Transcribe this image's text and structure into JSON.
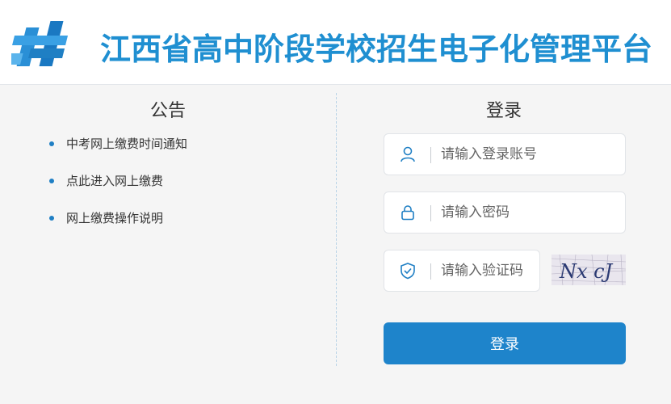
{
  "header": {
    "title": "江西省高中阶段学校招生电子化管理平台",
    "logo_icon": "cp-logo-icon",
    "brand_color": "#1f8fd1"
  },
  "notice": {
    "title": "公告",
    "items": [
      {
        "label": "中考网上缴费时间通知"
      },
      {
        "label": "点此进入网上缴费"
      },
      {
        "label": "网上缴费操作说明"
      }
    ]
  },
  "login": {
    "title": "登录",
    "username": {
      "placeholder": "请输入登录账号",
      "value": "",
      "icon": "user-icon"
    },
    "password": {
      "placeholder": "请输入密码",
      "value": "",
      "icon": "lock-icon"
    },
    "captcha": {
      "placeholder": "请输入验证码",
      "value": "",
      "icon": "shield-icon",
      "image_text": "Nx cJ"
    },
    "submit_label": "登录",
    "button_color": "#1e84cb"
  }
}
